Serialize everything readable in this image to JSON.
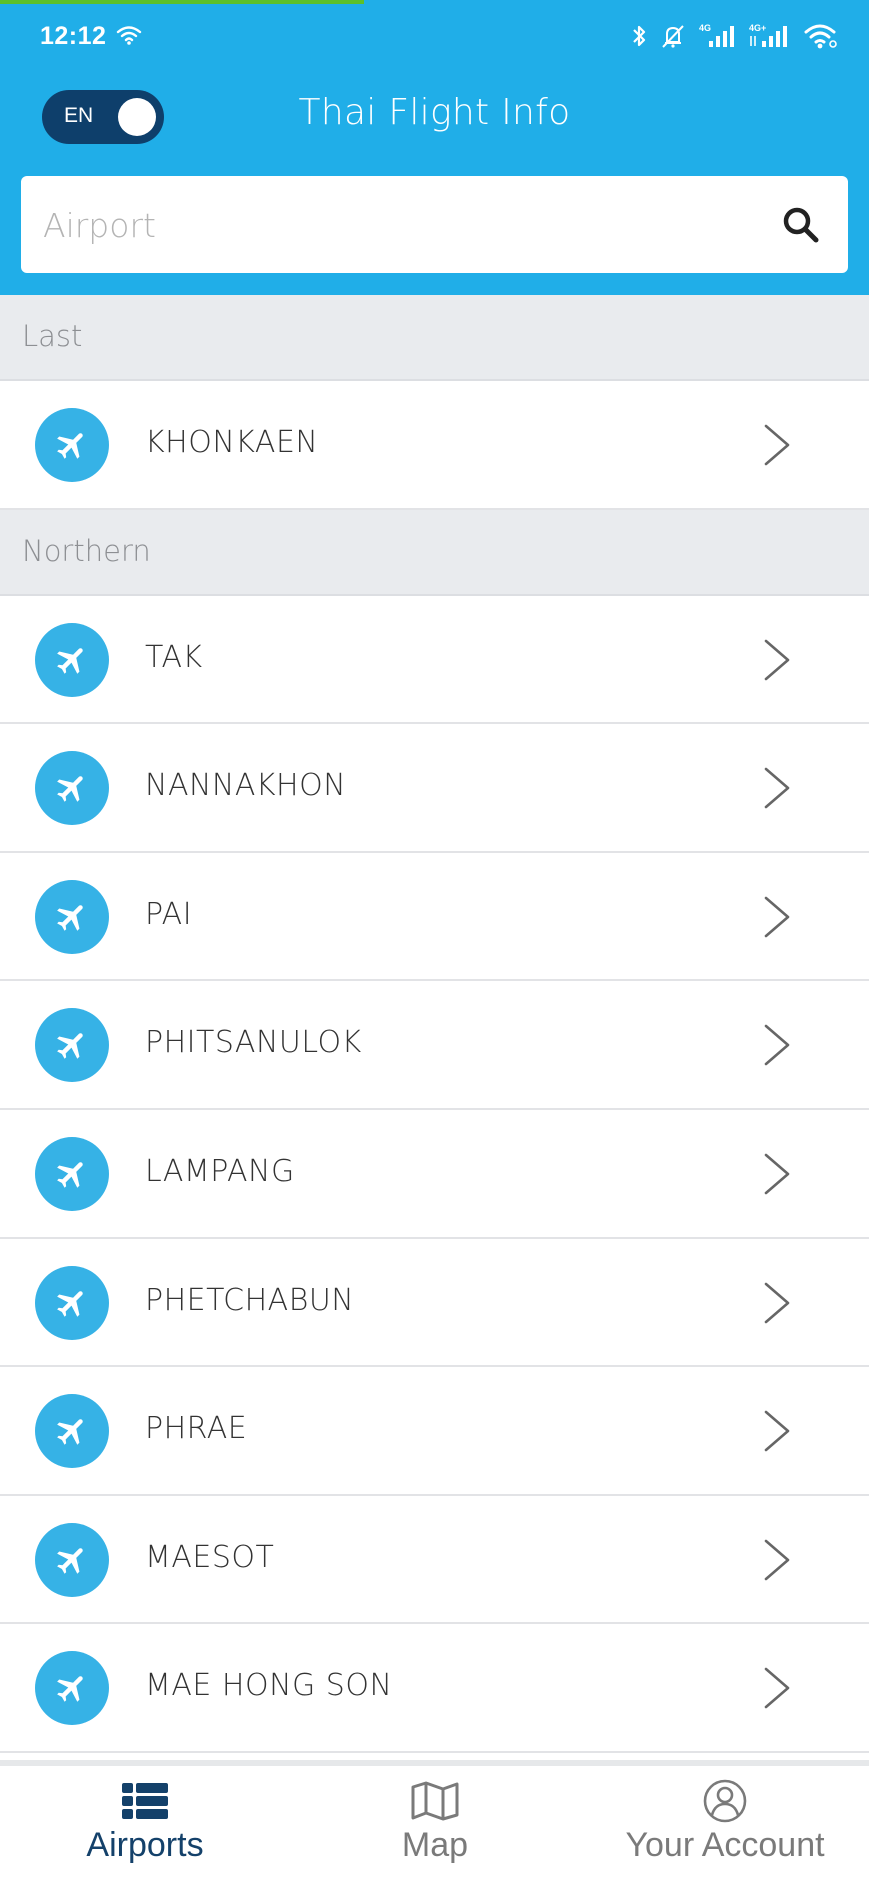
{
  "status_bar": {
    "time": "12:12",
    "icons": [
      "wifi-icon",
      "bluetooth-icon",
      "mute-icon",
      "signal-4g-icon",
      "signal-4g-plus-icon",
      "wifi-icon"
    ],
    "network_labels": [
      "4G",
      "4G+"
    ]
  },
  "header": {
    "title": "Thai Flight Info",
    "language_toggle": {
      "label": "EN",
      "on": true
    },
    "search": {
      "placeholder": "Airport",
      "value": ""
    }
  },
  "colors": {
    "primary": "#20aee8",
    "toggle_bg": "#0e3f6b",
    "icon_circle": "#36b2e6",
    "active_nav": "#14416a",
    "inactive_nav": "#7a7a7a",
    "section_bg": "#e9ebee"
  },
  "sections": [
    {
      "title": "Last",
      "items": [
        {
          "name": "KHONKAEN"
        }
      ]
    },
    {
      "title": "Northern",
      "items": [
        {
          "name": "TAK"
        },
        {
          "name": "NANNAKHON"
        },
        {
          "name": "PAI"
        },
        {
          "name": "PHITSANULOK"
        },
        {
          "name": "LAMPANG"
        },
        {
          "name": "PHETCHABUN"
        },
        {
          "name": "PHRAE"
        },
        {
          "name": "MAESOT"
        },
        {
          "name": "MAE HONG SON"
        }
      ]
    }
  ],
  "bottom_nav": [
    {
      "label": "Airports",
      "icon": "list-icon",
      "active": true
    },
    {
      "label": "Map",
      "icon": "map-icon",
      "active": false
    },
    {
      "label": "Your Account",
      "icon": "account-icon",
      "active": false
    }
  ]
}
